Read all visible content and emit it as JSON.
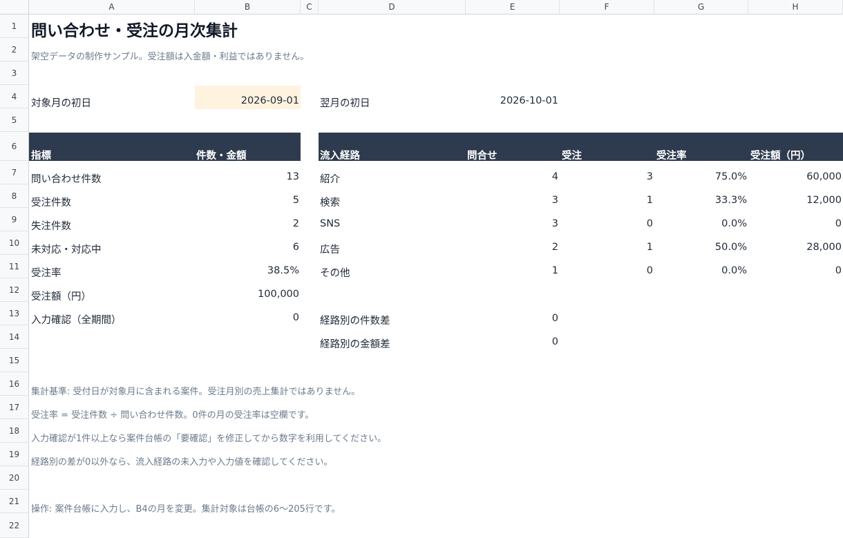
{
  "columns": [
    "A",
    "B",
    "C",
    "D",
    "E",
    "F",
    "G",
    "H"
  ],
  "rows": [
    "1",
    "2",
    "3",
    "4",
    "5",
    "6",
    "7",
    "8",
    "9",
    "10",
    "11",
    "12",
    "13",
    "14",
    "15",
    "16",
    "17",
    "18",
    "19",
    "20",
    "21",
    "22"
  ],
  "title": "問い合わせ・受注の月次集計",
  "subtitle": "架空データの制作サンプル。受注額は入金額・利益ではありません。",
  "params": {
    "target_label": "対象月の初日",
    "target_value": "2026-09-01",
    "next_label": "翌月の初日",
    "next_value": "2026-10-01"
  },
  "summary": {
    "headers": [
      "指標",
      "件数・金額"
    ],
    "rows": [
      {
        "label": "問い合わせ件数",
        "value": "13"
      },
      {
        "label": "受注件数",
        "value": "5"
      },
      {
        "label": "失注件数",
        "value": "2"
      },
      {
        "label": "未対応・対応中",
        "value": "6"
      },
      {
        "label": "受注率",
        "value": "38.5%"
      },
      {
        "label": "受注額（円）",
        "value": "100,000"
      },
      {
        "label": "入力確認（全期間）",
        "value": "0"
      }
    ]
  },
  "channels": {
    "headers": [
      "流入経路",
      "問合せ",
      "受注",
      "受注率",
      "受注額（円）"
    ],
    "rows": [
      {
        "name": "紹介",
        "inquiries": "4",
        "orders": "3",
        "rate": "75.0%",
        "amount": "60,000"
      },
      {
        "name": "検索",
        "inquiries": "3",
        "orders": "1",
        "rate": "33.3%",
        "amount": "12,000"
      },
      {
        "name": "SNS",
        "inquiries": "3",
        "orders": "0",
        "rate": "0.0%",
        "amount": "0"
      },
      {
        "name": "広告",
        "inquiries": "2",
        "orders": "1",
        "rate": "50.0%",
        "amount": "28,000"
      },
      {
        "name": "その他",
        "inquiries": "1",
        "orders": "0",
        "rate": "0.0%",
        "amount": "0"
      }
    ]
  },
  "checks": [
    {
      "label": "経路別の件数差",
      "value": "0"
    },
    {
      "label": "経路別の金額差",
      "value": "0"
    }
  ],
  "notes": [
    "集計基準: 受付日が対象月に含まれる案件。受注月別の売上集計ではありません。",
    "受注率 = 受注件数 ÷ 問い合わせ件数。0件の月の受注率は空欄です。",
    "入力確認が1件以上なら案件台帳の「要確認」を修正してから数字を利用してください。",
    "経路別の差が0以外なら、流入経路の未入力や入力値を確認してください。"
  ],
  "operation_note": "操作: 案件台帳に入力し、B4の月を変更。集計対象は台帳の6〜205行です。",
  "colors": {
    "header_band": "#2e3b4e",
    "input_fill": "#fdf3df",
    "note_text": "#6b7a8c"
  }
}
